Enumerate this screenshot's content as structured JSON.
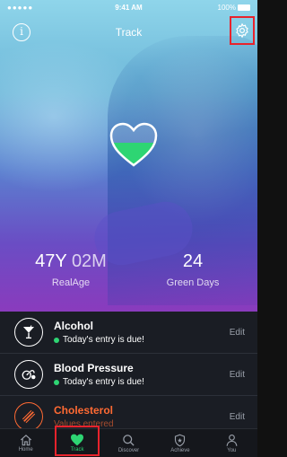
{
  "status_bar": {
    "signal": "●●●●● ",
    "time": "9:41 AM",
    "battery": "100%"
  },
  "nav": {
    "title": "Track",
    "info_glyph": "i"
  },
  "stats": {
    "real_age_years": "47Y",
    "real_age_months": "02M",
    "real_age_label": "RealAge",
    "green_days_value": "24",
    "green_days_label": "Green Days"
  },
  "list": [
    {
      "icon": "cocktail-icon",
      "title": "Alcohol",
      "subtitle": "Today's entry is due!",
      "action": "Edit"
    },
    {
      "icon": "blood-pressure-icon",
      "title": "Blood Pressure",
      "subtitle": "Today's entry is due!",
      "action": "Edit"
    },
    {
      "icon": "cholesterol-icon",
      "title": "Cholesterol",
      "subtitle": "Values entered",
      "action": "Edit"
    }
  ],
  "tabs": [
    {
      "label": "Home",
      "icon": "home-icon"
    },
    {
      "label": "Track",
      "icon": "heart-icon"
    },
    {
      "label": "Discover",
      "icon": "search-icon"
    },
    {
      "label": "Achieve",
      "icon": "shield-star-icon"
    },
    {
      "label": "You",
      "icon": "person-icon"
    }
  ],
  "colors": {
    "accent_green": "#2ed573",
    "highlight_red": "#e8232c",
    "cholesterol_orange": "#ff6a33"
  }
}
